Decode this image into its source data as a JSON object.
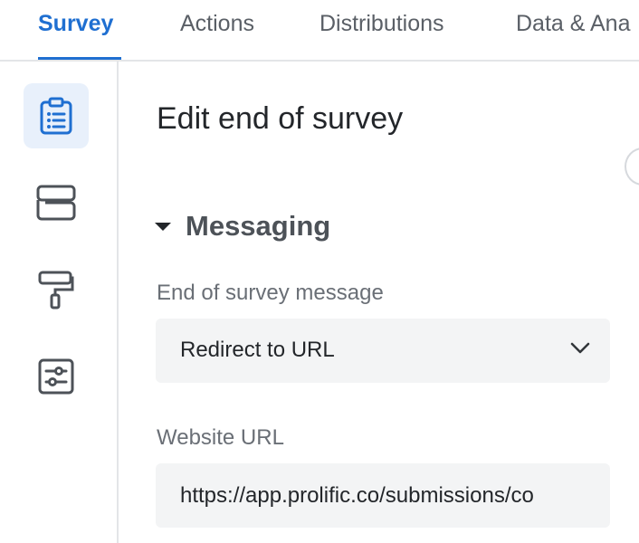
{
  "tabs": [
    {
      "label": "Survey",
      "active": true
    },
    {
      "label": "Actions",
      "active": false
    },
    {
      "label": "Distributions",
      "active": false
    },
    {
      "label": "Data & Ana",
      "active": false
    }
  ],
  "sidebar": {
    "items": [
      {
        "icon": "clipboard-icon",
        "active": true
      },
      {
        "icon": "blocks-layout-icon",
        "active": false
      },
      {
        "icon": "paint-roller-icon",
        "active": false
      },
      {
        "icon": "sliders-settings-icon",
        "active": false
      }
    ]
  },
  "panel": {
    "title": "Edit end of survey",
    "section": {
      "title": "Messaging",
      "expanded": true
    },
    "end_message": {
      "label": "End of survey message",
      "value": "Redirect to URL"
    },
    "website_url": {
      "label": "Website URL",
      "value": "https://app.prolific.co/submissions/co"
    }
  },
  "colors": {
    "accent": "#1f6fd1",
    "active_bg": "#e8f0fb",
    "field_bg": "#f3f4f5"
  }
}
